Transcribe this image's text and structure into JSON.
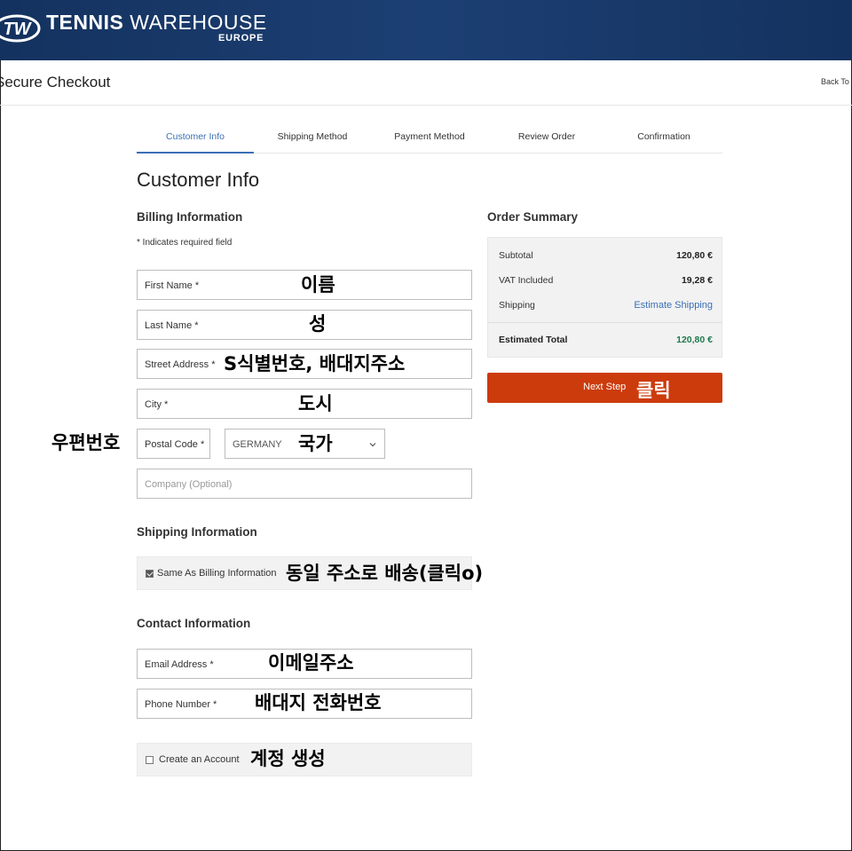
{
  "header": {
    "brand_main_bold": "TENNIS",
    "brand_main_light": "WAREHOUSE",
    "brand_sub": "EUROPE",
    "logo_text": "TW",
    "colors": {
      "header_bg": "#1c3f73",
      "accent": "#3b6fb6",
      "button": "#cc3b0c"
    }
  },
  "subheader": {
    "title": "Secure Checkout",
    "back_link": "Back To Cart"
  },
  "steps": [
    "Customer Info",
    "Shipping Method",
    "Payment Method",
    "Review Order",
    "Confirmation"
  ],
  "page_title": "Customer Info",
  "billing": {
    "heading": "Billing Information",
    "required_note": "* Indicates required field",
    "first_name": "First Name *",
    "last_name": "Last Name *",
    "street": "Street Address *",
    "city": "City *",
    "postal": "Postal Code *",
    "country": "GERMANY",
    "company": "Company (Optional)"
  },
  "shipping": {
    "heading": "Shipping Information",
    "same_as_billing": "Same As Billing Information"
  },
  "contact": {
    "heading": "Contact Information",
    "email": "Email Address *",
    "phone": "Phone Number *",
    "create_account": "Create an Account"
  },
  "summary": {
    "heading": "Order Summary",
    "subtotal_label": "Subtotal",
    "subtotal_value": "120,80 €",
    "vat_label": "VAT Included",
    "vat_value": "19,28 €",
    "shipping_label": "Shipping",
    "shipping_value": "Estimate Shipping",
    "total_label": "Estimated Total",
    "total_value": "120,80 €"
  },
  "next_step": "Next Step",
  "annotations": {
    "first_name": "이름",
    "last_name": "성",
    "street": "S식별번호, 배대지주소",
    "city": "도시",
    "postal": "우편번호",
    "country": "국가",
    "same_as_billing": "동일 주소로 배송(클릭o)",
    "email": "이메일주소",
    "phone": "배대지 전화번호",
    "create_account": "계정 생성",
    "next_step": "클릭"
  }
}
